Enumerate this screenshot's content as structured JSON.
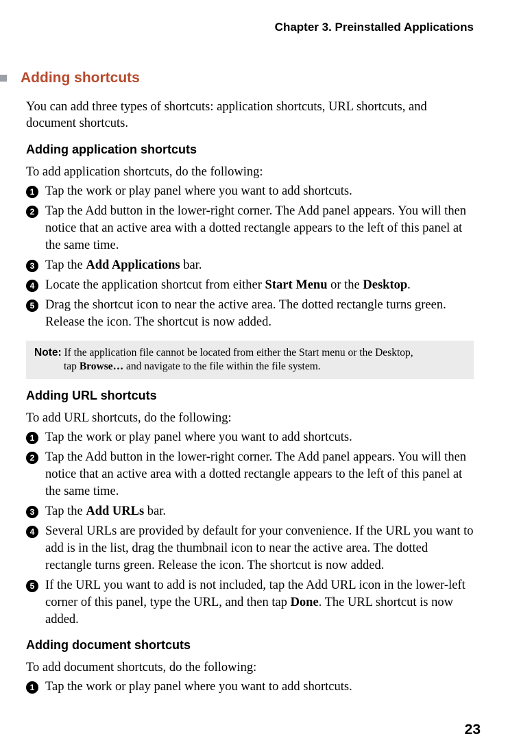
{
  "chapter_header": "Chapter 3. Preinstalled Applications",
  "section": {
    "title": "Adding shortcuts",
    "intro": "You can add three types of shortcuts: application shortcuts, URL shortcuts, and document shortcuts."
  },
  "sub1": {
    "heading": "Adding application shortcuts",
    "intro": "To add application shortcuts, do the following:",
    "steps": {
      "s1": "Tap the work or play panel where you want to add shortcuts.",
      "s2": "Tap the Add button in the lower-right corner. The Add panel appears. You will then notice that an active area with a dotted rectangle appears to the left of this panel at the same time.",
      "s3_a": "Tap the ",
      "s3_b": "Add Applications",
      "s3_c": " bar.",
      "s4_a": "Locate the application shortcut from either ",
      "s4_b": "Start Menu",
      "s4_c": " or the ",
      "s4_d": "Desktop",
      "s4_e": ".",
      "s5": "Drag the shortcut icon to near the active area. The dotted rectangle turns green. Release the icon. The shortcut is now added."
    },
    "note": {
      "label": "Note:",
      "line1": " If the application file cannot be located from either the Start menu or the Desktop,",
      "line2_a": "tap ",
      "line2_b": "Browse…",
      "line2_c": " and navigate to the file within the file system."
    }
  },
  "sub2": {
    "heading": "Adding URL shortcuts",
    "intro": "To add URL shortcuts, do the following:",
    "steps": {
      "s1": "Tap the work or play panel where you want to add shortcuts.",
      "s2": "Tap the Add button in the lower-right corner. The Add panel appears. You will then notice that an active area with a dotted rectangle appears to the left of this panel at the same time.",
      "s3_a": "Tap the ",
      "s3_b": "Add URLs",
      "s3_c": " bar.",
      "s4": "Several URLs are provided by default for your convenience. If the URL you want to add is in the list, drag the thumbnail icon to near the active area. The dotted rectangle turns green. Release the icon. The shortcut is now added.",
      "s5_a": "If the URL you want to add is not included, tap the Add URL icon in the lower-left corner of this panel, type the URL, and then tap ",
      "s5_b": "Done",
      "s5_c": ". The URL shortcut is now added."
    }
  },
  "sub3": {
    "heading": "Adding document shortcuts",
    "intro": "To add document shortcuts, do the following:",
    "steps": {
      "s1": "Tap the work or play panel where you want to add shortcuts."
    }
  },
  "page_number": "23",
  "nums": {
    "n1": "1",
    "n2": "2",
    "n3": "3",
    "n4": "4",
    "n5": "5"
  }
}
